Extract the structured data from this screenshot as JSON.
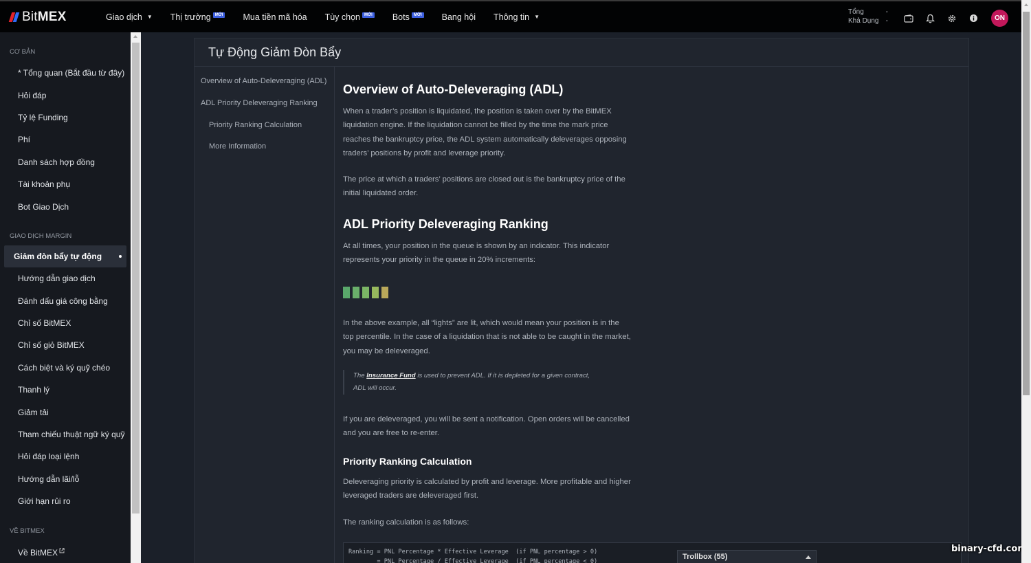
{
  "brand": {
    "name_light": "Bit",
    "name_bold": "MEX"
  },
  "nav": [
    {
      "label": "Giao dịch",
      "caret": true,
      "badge": ""
    },
    {
      "label": "Thị trường",
      "caret": false,
      "badge": "MỚI"
    },
    {
      "label": "Mua tiền mã hóa",
      "caret": false,
      "badge": ""
    },
    {
      "label": "Tùy chọn",
      "caret": false,
      "badge": "MỚI"
    },
    {
      "label": "Bots",
      "caret": false,
      "badge": "MỚI"
    },
    {
      "label": "Bang hội",
      "caret": false,
      "badge": ""
    },
    {
      "label": "Thông tin",
      "caret": true,
      "badge": ""
    }
  ],
  "balance": {
    "total_label": "Tổng",
    "total_value": "-",
    "available_label": "Khả Dụng",
    "available_value": "-"
  },
  "header_icons": [
    "wallet-icon",
    "bell-icon",
    "gear-icon",
    "info-icon"
  ],
  "user": {
    "initials": "ON",
    "avatar_color": "#c2185b"
  },
  "sidebar": {
    "sections": [
      {
        "title": "CƠ BẢN",
        "items": [
          {
            "label": "* Tổng quan (Bắt đầu từ đây)"
          },
          {
            "label": "Hỏi đáp"
          },
          {
            "label": "Tỷ lệ Funding"
          },
          {
            "label": "Phí"
          },
          {
            "label": "Danh sách hợp đồng"
          },
          {
            "label": "Tài khoản phụ"
          },
          {
            "label": "Bot Giao Dịch"
          }
        ]
      },
      {
        "title": "GIAO DỊCH MARGIN",
        "items": [
          {
            "label": "Giảm đòn bẩy tự động",
            "active": true
          },
          {
            "label": "Hướng dẫn giao dịch"
          },
          {
            "label": "Đánh dấu giá công bằng"
          },
          {
            "label": "Chỉ số BitMEX"
          },
          {
            "label": "Chỉ số giỏ BitMEX"
          },
          {
            "label": "Cách biệt và ký quỹ chéo"
          },
          {
            "label": "Thanh lý"
          },
          {
            "label": "Giảm tải"
          },
          {
            "label": "Tham chiếu thuật ngữ ký quỹ"
          },
          {
            "label": "Hỏi đáp loại lệnh"
          },
          {
            "label": "Hướng dẫn lãi/lỗ"
          },
          {
            "label": "Giới hạn rủi ro"
          }
        ]
      },
      {
        "title": "VỀ BITMEX",
        "items": [
          {
            "label": "Về BitMEX"
          }
        ]
      }
    ]
  },
  "page": {
    "title": "Tự Động Giảm Đòn Bẩy",
    "toc": [
      "Overview of Auto-Deleveraging (ADL)",
      "ADL Priority Deleveraging Ranking",
      "Priority Ranking Calculation",
      "More Information"
    ],
    "h1": "Overview of Auto-Deleveraging (ADL)",
    "p1": "When a trader’s position is liquidated, the position is taken over by the BitMEX liquidation engine. If the liquidation cannot be filled by the time the mark price reaches the bankruptcy price, the ADL system automatically deleverages opposing traders’ positions by profit and leverage priority.",
    "p2": "The price at which a traders’ positions are closed out is the bankruptcy price of the initial liquidated order.",
    "h2": "ADL Priority Deleveraging Ranking",
    "p3": "At all times, your position in the queue is shown by an indicator. This indicator represents your priority in the queue in 20% increments:",
    "lights_lit": 5,
    "light_colors": [
      "#5aa86b",
      "#6aaf6a",
      "#7bb565",
      "#97b95d",
      "#b9a85a"
    ],
    "p4": "In the above example, all “lights” are lit, which would mean your position is in the top percentile. In the case of a liquidation that is not able to be caught in the market, you may be deleveraged.",
    "quote_prefix": "The",
    "quote_link": "Insurance Fund",
    "quote_rest": "is used to prevent ADL. If it is depleted for a given contract, ADL will occur.",
    "p5": "If you are deleveraged, you will be sent a notification. Open orders will be cancelled and you are free to re-enter.",
    "h3": "Priority Ranking Calculation",
    "p6": "Deleveraging priority is calculated by profit and leverage. More profitable and higher leveraged traders are deleveraged first.",
    "p7": "The ranking calculation is as follows:",
    "code_line1": "Ranking = PNL Percentage * Effective Leverage  (if PNL percentage > 0)",
    "code_line2": "        = PNL Percentage / Effective Leverage  (if PNL percentage < 0)"
  },
  "trollbox": {
    "label": "Trollbox (55)"
  },
  "watermark": "binary-cfd.com"
}
